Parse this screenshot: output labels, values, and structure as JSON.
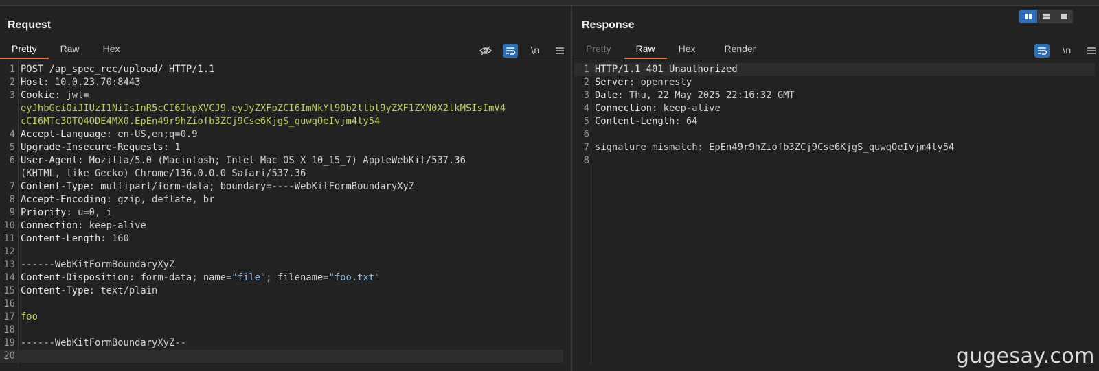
{
  "request": {
    "title": "Request",
    "tabs": [
      {
        "label": "Pretty"
      },
      {
        "label": "Raw"
      },
      {
        "label": "Hex"
      }
    ],
    "tools": {
      "newline": "\\n",
      "menu_icon": "hamburger-menu-icon",
      "hide_icon": "eye-slash-icon",
      "wrap_icon": "word-wrap-icon"
    },
    "lines": [
      {
        "n": "1",
        "k": "POST /ap_spec_rec/upload/ HTTP/1.1",
        "v": ""
      },
      {
        "n": "2",
        "k": "Host:",
        "v": " 10.0.23.70:8443"
      },
      {
        "n": "3",
        "k": "Cookie:",
        "v": " jwt="
      },
      {
        "n": "",
        "k": "",
        "c": "eyJhbGciOiJIUzI1NiIsInR5cCI6IkpXVCJ9.eyJyZXFpZCI6ImNkYl90b2tlbl9yZXF1ZXN0X2lkMSIsImV4"
      },
      {
        "n": "",
        "k": "",
        "c": "cCI6MTc3OTQ4ODE4MX0.EpEn49r9hZiofb3ZCj9Cse6KjgS_quwqOeIvjm4ly54"
      },
      {
        "n": "4",
        "k": "Accept-Language:",
        "v": " en-US,en;q=0.9"
      },
      {
        "n": "5",
        "k": "Upgrade-Insecure-Requests:",
        "v": " 1"
      },
      {
        "n": "6",
        "k": "User-Agent:",
        "v": " Mozilla/5.0 (Macintosh; Intel Mac OS X 10_15_7) AppleWebKit/537.36"
      },
      {
        "n": "",
        "k": "",
        "v": "(KHTML, like Gecko) Chrome/136.0.0.0 Safari/537.36"
      },
      {
        "n": "7",
        "k": "Content-Type:",
        "v": " multipart/form-data; boundary=----WebKitFormBoundaryXyZ"
      },
      {
        "n": "8",
        "k": "Accept-Encoding:",
        "v": " gzip, deflate, br"
      },
      {
        "n": "9",
        "k": "Priority:",
        "v": " u=0, i"
      },
      {
        "n": "10",
        "k": "Connection:",
        "v": " keep-alive"
      },
      {
        "n": "11",
        "k": "Content-Length:",
        "v": " 160"
      },
      {
        "n": "12",
        "k": "",
        "v": ""
      },
      {
        "n": "13",
        "k": "",
        "v": "------WebKitFormBoundaryXyZ"
      },
      {
        "n": "14",
        "k": "Content-Disposition:",
        "v": " form-data; name=",
        "s1": "\"file\"",
        "v2": "; filename=",
        "s2": "\"foo.txt\""
      },
      {
        "n": "15",
        "k": "Content-Type:",
        "v": " text/plain"
      },
      {
        "n": "16",
        "k": "",
        "v": ""
      },
      {
        "n": "17",
        "k": "",
        "c": "foo"
      },
      {
        "n": "18",
        "k": "",
        "v": ""
      },
      {
        "n": "19",
        "k": "",
        "v": "------WebKitFormBoundaryXyZ--"
      },
      {
        "n": "20",
        "k": "",
        "v": ""
      }
    ]
  },
  "response": {
    "title": "Response",
    "tabs": [
      {
        "label": "Pretty"
      },
      {
        "label": "Raw"
      },
      {
        "label": "Hex"
      },
      {
        "label": "Render"
      }
    ],
    "tools": {
      "newline": "\\n",
      "menu_icon": "hamburger-menu-icon",
      "wrap_icon": "word-wrap-icon"
    },
    "lines": [
      {
        "n": "1",
        "k": "HTTP/1.1 401 Unauthorized",
        "v": ""
      },
      {
        "n": "2",
        "k": "Server:",
        "v": " openresty"
      },
      {
        "n": "3",
        "k": "Date:",
        "v": " Thu, 22 May 2025 22:16:32 GMT"
      },
      {
        "n": "4",
        "k": "Connection:",
        "v": " keep-alive"
      },
      {
        "n": "5",
        "k": "Content-Length:",
        "v": " 64"
      },
      {
        "n": "6",
        "k": "",
        "v": ""
      },
      {
        "n": "7",
        "k": "",
        "v": "signature mismatch: EpEn49r9hZiofb3ZCj9Cse6KjgS_quwqOeIvjm4ly54"
      },
      {
        "n": "8",
        "k": "",
        "v": ""
      }
    ]
  },
  "layout_toggle": {
    "options": [
      "side-by-side-layout-icon",
      "stacked-layout-icon",
      "single-pane-layout-icon"
    ],
    "selected": "side-by-side-layout-icon"
  },
  "colors": {
    "accent": "#e8743b",
    "active_button": "#2c6fb8",
    "cookie_value": "#c3cf62",
    "string_value": "#93c1ec"
  },
  "watermark": "gugesay.com"
}
